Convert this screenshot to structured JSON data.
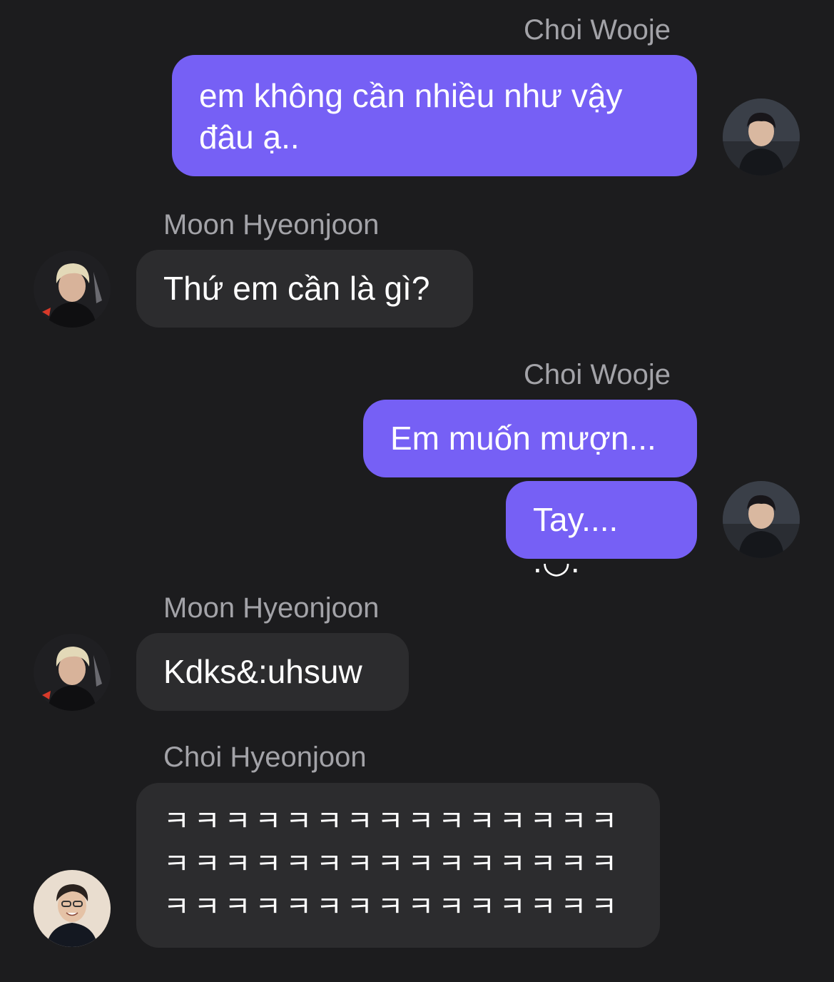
{
  "messages": [
    {
      "sender": "Choi Wooje",
      "text_lines": [
        "em không cần nhiều như vậy",
        "đâu ạ.."
      ],
      "direction": "outgoing",
      "avatar_icon": "user-photo-icon"
    },
    {
      "sender": "Moon Hyeonjoon",
      "text": "Thứ em cần là gì?",
      "direction": "incoming",
      "avatar_icon": "user-photo-icon"
    },
    {
      "sender": "Choi Wooje",
      "texts": [
        "Em muốn mượn...",
        "Tay.... .◡."
      ],
      "direction": "outgoing",
      "avatar_icon": "user-photo-icon"
    },
    {
      "sender": "Moon Hyeonjoon",
      "text": "Kdks&:uhsuw",
      "direction": "incoming",
      "avatar_icon": "user-photo-icon"
    },
    {
      "sender": "Choi Hyeonjoon",
      "text_lines": [
        "ㅋㅋㅋㅋㅋㅋㅋㅋㅋㅋㅋㅋㅋㅋㅋ",
        "ㅋㅋㅋㅋㅋㅋㅋㅋㅋㅋㅋㅋㅋㅋㅋ",
        "ㅋㅋㅋㅋㅋㅋㅋㅋㅋㅋㅋㅋㅋㅋㅋ"
      ],
      "direction": "incoming",
      "avatar_icon": "user-photo-icon"
    }
  ],
  "colors": {
    "background": "#1c1c1e",
    "outgoing_bubble": "#7660f5",
    "incoming_bubble": "#2c2c2e",
    "sender_name": "#a3a3a8"
  }
}
